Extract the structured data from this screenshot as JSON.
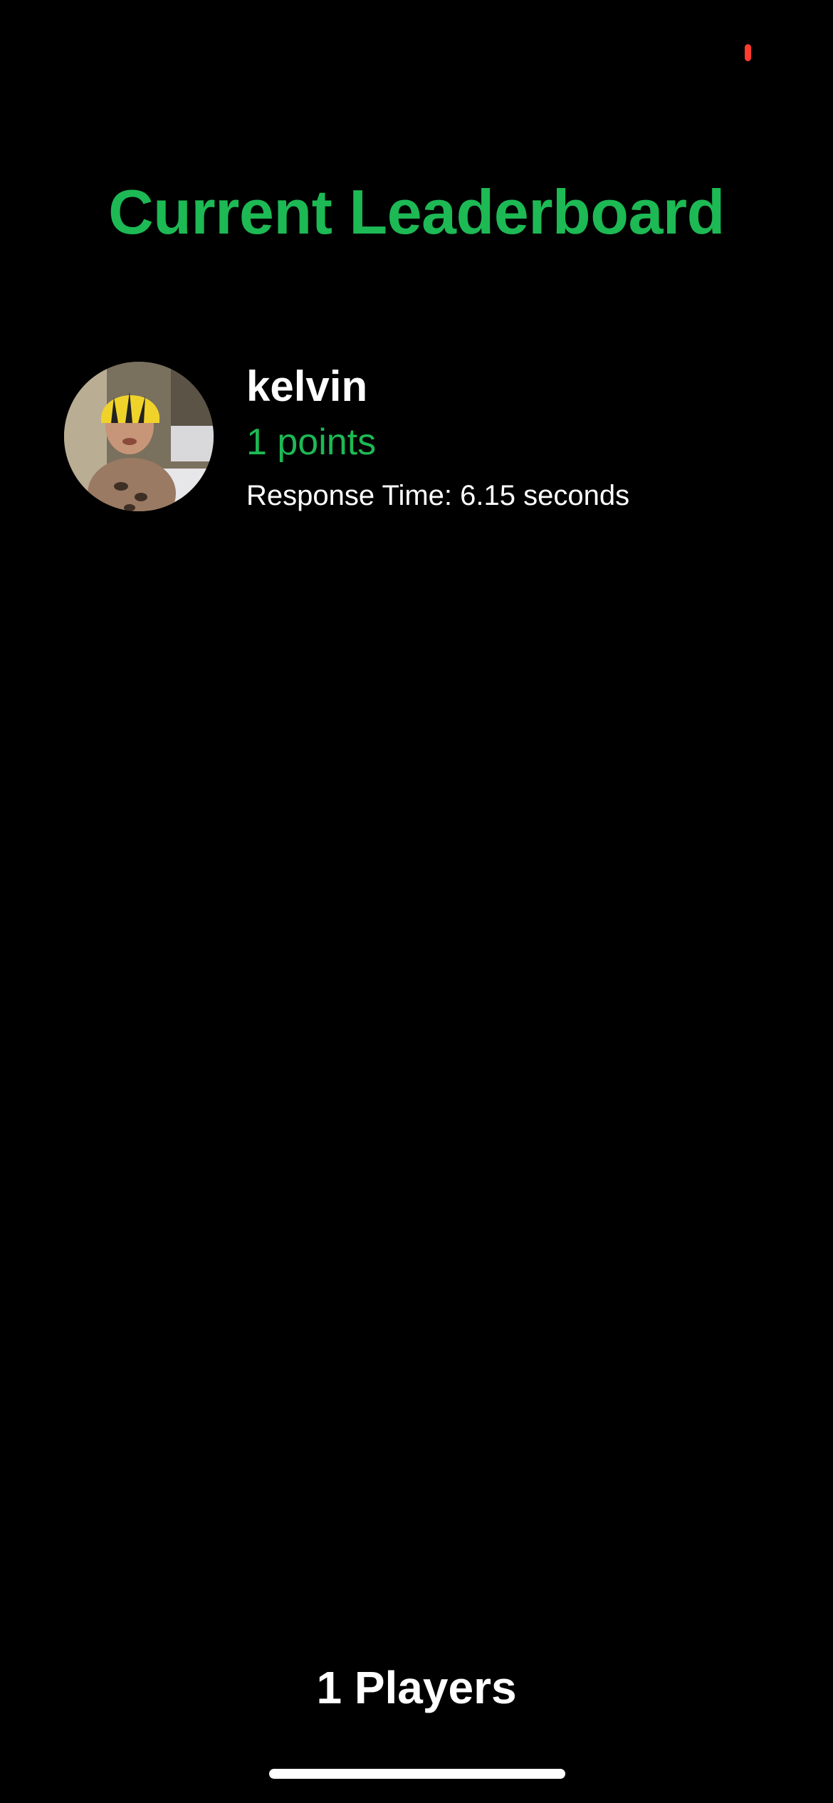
{
  "theme": {
    "background": "#000000",
    "accent": "#1DB954",
    "text": "#FFFFFF",
    "status_dot": "#FF3B30"
  },
  "status_bar": {
    "indicator_icon": "recording-indicator-icon"
  },
  "header": {
    "title": "Current Leaderboard"
  },
  "leaderboard": {
    "entries": [
      {
        "avatar_icon": "player-avatar-photo",
        "name": "kelvin",
        "points": "1 points",
        "response_time": "Response Time: 6.15 seconds"
      }
    ]
  },
  "footer": {
    "players_count": "1 Players"
  }
}
